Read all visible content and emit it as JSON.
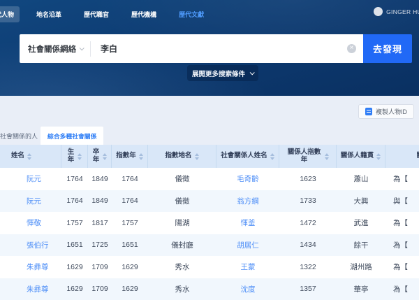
{
  "nav": {
    "items": [
      {
        "label": "歷代人物"
      },
      {
        "label": "地名沿革"
      },
      {
        "label": "歷代職官"
      },
      {
        "label": "歷代機構"
      },
      {
        "label": "歷代文獻"
      }
    ],
    "user_name": "GINGER HU"
  },
  "search": {
    "category": "社會關係網絡",
    "query": "李白",
    "submit_label": "去發現",
    "expand_label": "展開更多搜索條件"
  },
  "toolbar": {
    "copy_id_label": "複製人物ID"
  },
  "tabs": [
    {
      "label": "有社會關係的人",
      "active": false
    },
    {
      "label": "綜合多種社會關係",
      "active": true
    }
  ],
  "table": {
    "columns": [
      "姓名",
      "生年",
      "卒年",
      "指數年",
      "指數地名",
      "社會關係人姓名",
      "關係人指數年",
      "關係人籍貫",
      "關係"
    ],
    "rows": [
      {
        "name": "阮元",
        "birth": "1764",
        "death": "1849",
        "index_year": "1764",
        "index_place": "儀徵",
        "rel_name": "毛奇齡",
        "rel_index_year": "1623",
        "rel_origin": "蕭山",
        "relation": "為【"
      },
      {
        "name": "阮元",
        "birth": "1764",
        "death": "1849",
        "index_year": "1764",
        "index_place": "儀徵",
        "rel_name": "翁方綱",
        "rel_index_year": "1733",
        "rel_origin": "大興",
        "relation": "與【"
      },
      {
        "name": "惲敬",
        "birth": "1757",
        "death": "1817",
        "index_year": "1757",
        "index_place": "陽湖",
        "rel_name": "惲釜",
        "rel_index_year": "1472",
        "rel_origin": "武進",
        "relation": "為【"
      },
      {
        "name": "張伯行",
        "birth": "1651",
        "death": "1725",
        "index_year": "1651",
        "index_place": "儀封廳",
        "rel_name": "胡居仁",
        "rel_index_year": "1434",
        "rel_origin": "餘干",
        "relation": "為【"
      },
      {
        "name": "朱彝尊",
        "birth": "1629",
        "death": "1709",
        "index_year": "1629",
        "index_place": "秀水",
        "rel_name": "王蒙",
        "rel_index_year": "1322",
        "rel_origin": "湖州路",
        "relation": "為【"
      },
      {
        "name": "朱彝尊",
        "birth": "1629",
        "death": "1709",
        "index_year": "1629",
        "index_place": "秀水",
        "rel_name": "沈度",
        "rel_index_year": "1357",
        "rel_origin": "華亭",
        "relation": "為【"
      }
    ]
  },
  "colors": {
    "header_blue": "#0d3b72",
    "accent_blue": "#2169f6",
    "link_blue": "#4a8cf7",
    "table_header_bg": "#d9e7f8",
    "page_bg": "#e9eef7"
  }
}
